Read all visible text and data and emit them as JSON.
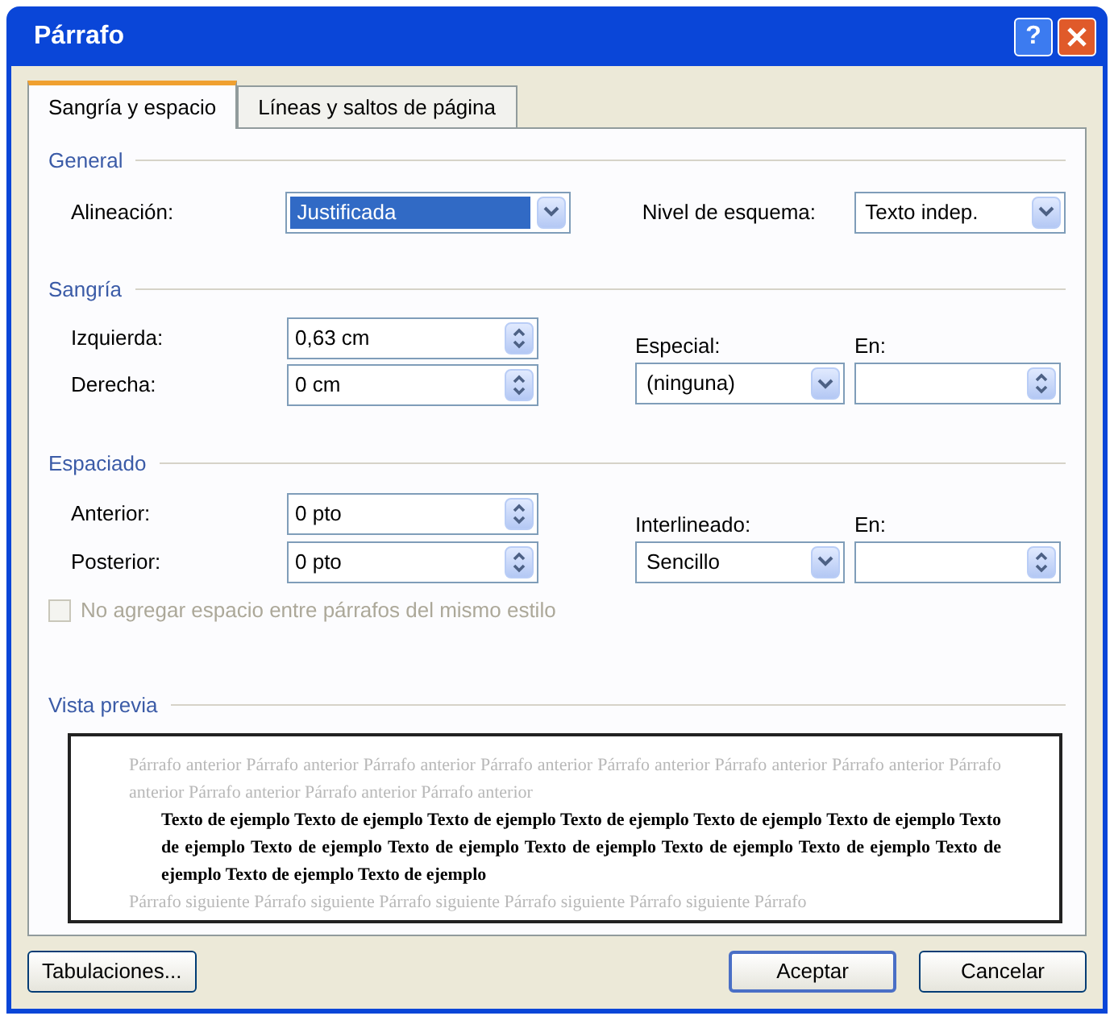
{
  "window": {
    "title": "Párrafo",
    "help_glyph": "?"
  },
  "tabs": [
    {
      "label": "Sangría y espacio",
      "selected": true
    },
    {
      "label": "Líneas y saltos de página",
      "selected": false
    }
  ],
  "general": {
    "heading": "General",
    "alignment": {
      "label": "Alineación:",
      "value": "Justificada",
      "focused": true
    },
    "outline_level": {
      "label": "Nivel de esquema:",
      "value": "Texto indep."
    }
  },
  "indentation": {
    "heading": "Sangría",
    "left": {
      "label": "Izquierda:",
      "value": "0,63 cm"
    },
    "right": {
      "label": "Derecha:",
      "value": "0 cm"
    },
    "special": {
      "label": "Especial:",
      "value": "(ninguna)"
    },
    "by": {
      "label": "En:"
    }
  },
  "spacing": {
    "heading": "Espaciado",
    "before": {
      "label": "Anterior:",
      "value": "0 pto"
    },
    "after": {
      "label": "Posterior:",
      "value": "0 pto"
    },
    "line_spacing": {
      "label": "Interlineado:",
      "value": "Sencillo"
    },
    "at": {
      "label": "En:"
    },
    "no_space_checkbox": {
      "label": "No agregar espacio entre párrafos del mismo estilo",
      "checked": false,
      "disabled": true
    }
  },
  "preview": {
    "heading": "Vista previa",
    "previous": "Párrafo anterior Párrafo anterior Párrafo anterior Párrafo anterior Párrafo anterior Párrafo anterior Párrafo anterior Párrafo anterior Párrafo anterior Párrafo anterior Párrafo anterior",
    "sample": "Texto de ejemplo Texto de ejemplo Texto de ejemplo Texto de ejemplo Texto de ejemplo Texto de ejemplo Texto de ejemplo Texto de ejemplo Texto de ejemplo Texto de ejemplo Texto de ejemplo Texto de ejemplo Texto de ejemplo Texto de ejemplo Texto de ejemplo",
    "next": "Párrafo siguiente Párrafo siguiente Párrafo siguiente Párrafo siguiente Párrafo siguiente Párrafo"
  },
  "buttons": [
    {
      "label": "Tabulaciones...",
      "kind": "secondary"
    },
    {
      "label": "Aceptar",
      "kind": "default"
    },
    {
      "label": "Cancelar",
      "kind": "secondary"
    }
  ]
}
